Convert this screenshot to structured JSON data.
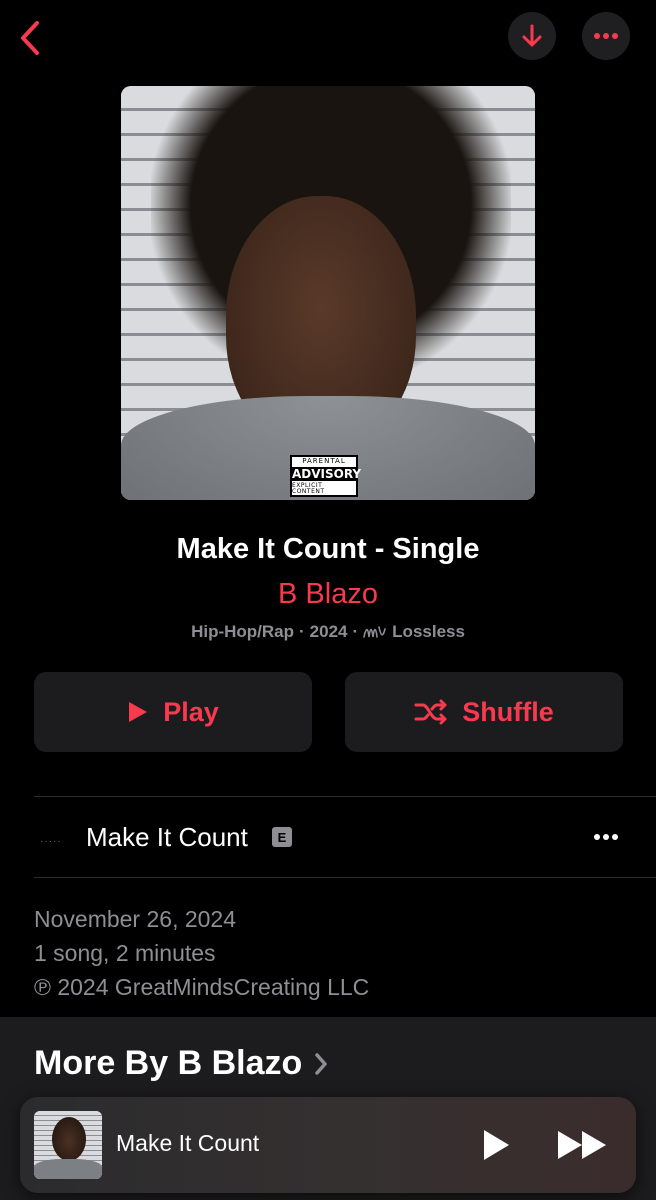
{
  "colors": {
    "accent": "#f83a4f",
    "background": "#000000",
    "secondary_text": "#8e8e93",
    "button_bg": "#1c1c1e"
  },
  "topbar": {
    "back_icon": "chevron-left-icon",
    "download_icon": "arrow-down-icon",
    "more_icon": "ellipsis-icon"
  },
  "album": {
    "artwork_badge": {
      "line1": "PARENTAL",
      "line2": "ADVISORY",
      "line3": "EXPLICIT CONTENT"
    },
    "title": "Make It Count - Single",
    "artist": "B Blazo",
    "genre": "Hip-Hop/Rap",
    "year": "2024",
    "quality": "Lossless",
    "separator": "·"
  },
  "actions": {
    "play_label": "Play",
    "shuffle_label": "Shuffle"
  },
  "tracks": [
    {
      "number_indicator": "·····",
      "title": "Make It Count",
      "explicit": "E"
    }
  ],
  "info": {
    "release_date": "November 26, 2024",
    "summary": "1 song, 2 minutes",
    "copyright": "℗ 2024 GreatMindsCreating LLC"
  },
  "more_by": {
    "title": "More By B Blazo"
  },
  "now_playing": {
    "title": "Make It Count"
  }
}
